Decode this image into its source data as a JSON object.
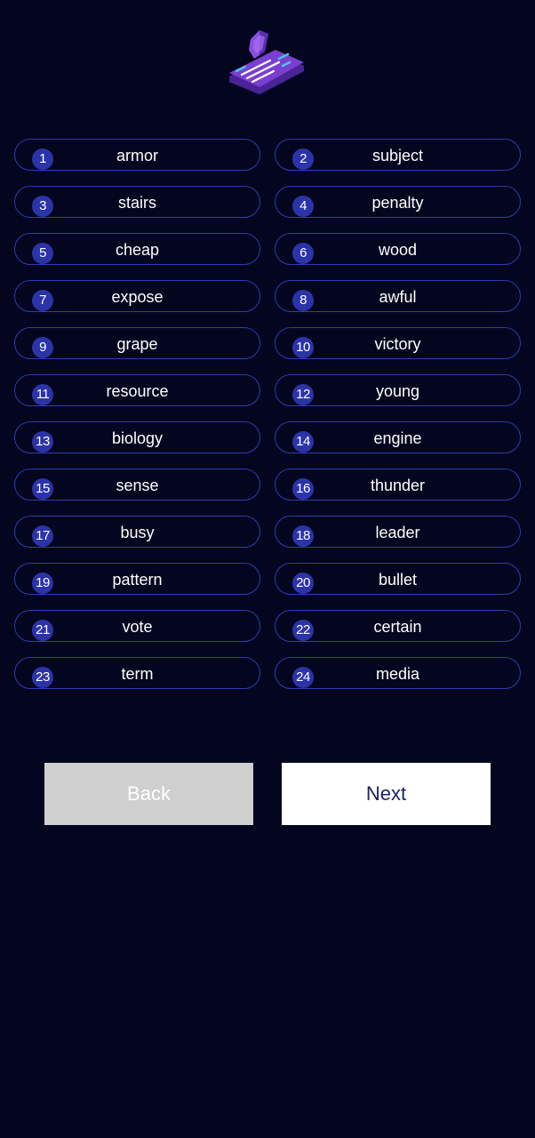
{
  "logo": {
    "icon": "shield-document-icon",
    "colors": {
      "primary": "#7a3fd0",
      "dark": "#4a2496",
      "accent": "#44c7e8",
      "line": "#ffffff"
    }
  },
  "words": [
    {
      "num": "1",
      "word": "armor"
    },
    {
      "num": "2",
      "word": "subject"
    },
    {
      "num": "3",
      "word": "stairs"
    },
    {
      "num": "4",
      "word": "penalty"
    },
    {
      "num": "5",
      "word": "cheap"
    },
    {
      "num": "6",
      "word": "wood"
    },
    {
      "num": "7",
      "word": "expose"
    },
    {
      "num": "8",
      "word": "awful"
    },
    {
      "num": "9",
      "word": "grape"
    },
    {
      "num": "10",
      "word": "victory"
    },
    {
      "num": "11",
      "word": "resource"
    },
    {
      "num": "12",
      "word": "young"
    },
    {
      "num": "13",
      "word": "biology"
    },
    {
      "num": "14",
      "word": "engine"
    },
    {
      "num": "15",
      "word": "sense"
    },
    {
      "num": "16",
      "word": "thunder"
    },
    {
      "num": "17",
      "word": "busy"
    },
    {
      "num": "18",
      "word": "leader"
    },
    {
      "num": "19",
      "word": "pattern"
    },
    {
      "num": "20",
      "word": "bullet"
    },
    {
      "num": "21",
      "word": "vote"
    },
    {
      "num": "22",
      "word": "certain"
    },
    {
      "num": "23",
      "word": "term"
    },
    {
      "num": "24",
      "word": "media"
    }
  ],
  "buttons": {
    "back_label": "Back",
    "next_label": "Next"
  },
  "colors": {
    "background": "#03061e",
    "pill_border": "#2f3bb5",
    "badge": "#2b33a8",
    "back_button": "#cfcfcf",
    "next_text": "#1c2260"
  }
}
